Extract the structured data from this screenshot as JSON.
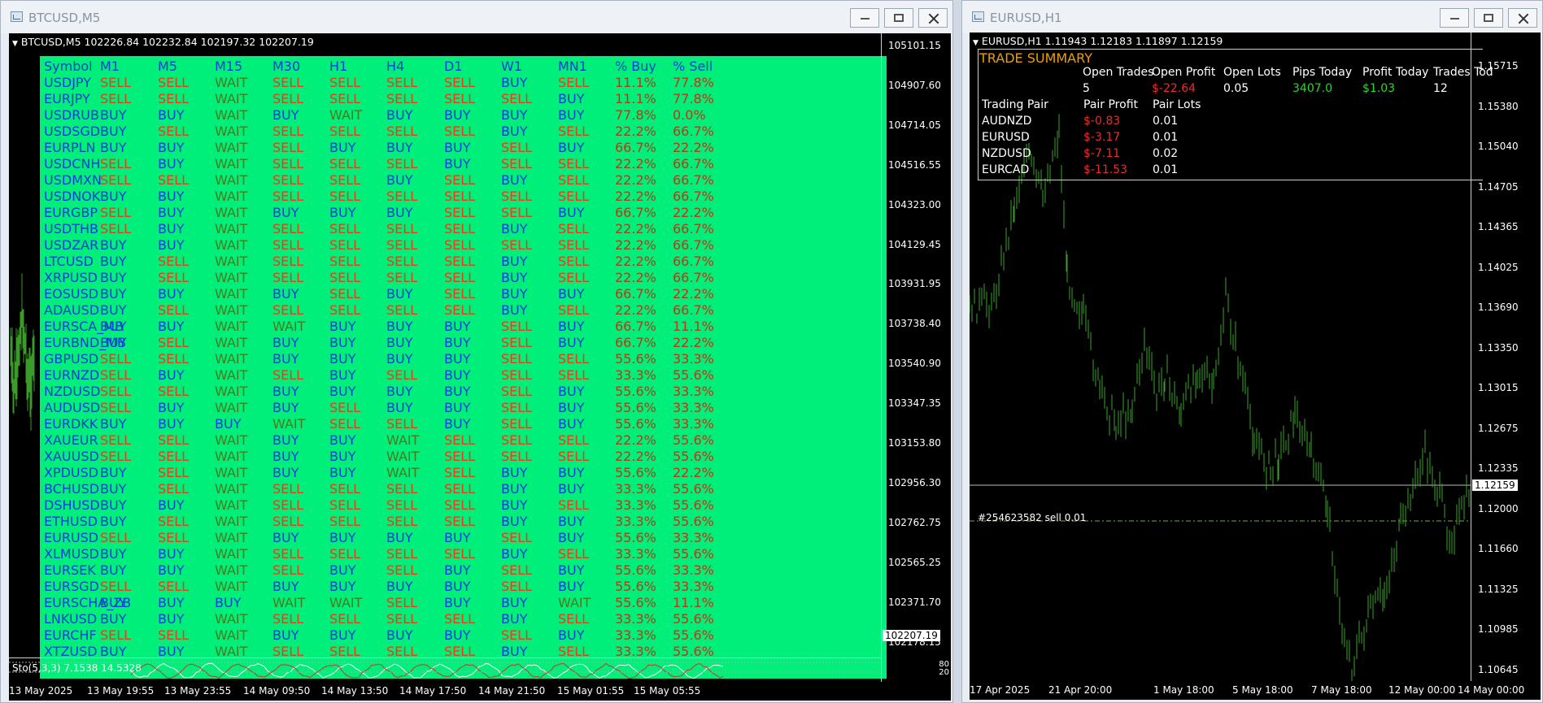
{
  "windows": {
    "left": {
      "title": "BTCUSD,M5"
    },
    "right": {
      "title": "EURUSD,H1"
    }
  },
  "colors": {
    "buy": "#0b3fd8",
    "sell": "#f03a14",
    "wait": "#4a7a1a",
    "symbol": "#0b3fd8",
    "percent": "#b83a16",
    "header": "#0b3fd8",
    "grid_bg": "#00ee7a",
    "summary_title": "#e6a100",
    "green": "#22dd22",
    "red": "#ee2a2a"
  },
  "btc": {
    "info": "BTCUSD,M5  102226.84 102232.84 102197.32 102207.19",
    "price_labels": [
      "105101.15",
      "104907.60",
      "104714.05",
      "104516.55",
      "104323.00",
      "104129.45",
      "103931.95",
      "103738.40",
      "103540.90",
      "103347.35",
      "103153.80",
      "102956.30",
      "102762.75",
      "102565.25",
      "102371.70",
      "102178.15"
    ],
    "current_price": "102207.19",
    "time_labels": [
      "13 May 2025",
      "13 May 19:55",
      "13 May 23:55",
      "14 May 09:50",
      "14 May 13:50",
      "14 May 17:50",
      "14 May 21:50",
      "15 May 01:55",
      "15 May 05:55"
    ],
    "stochastic": {
      "label": "Sto(5,3,3) 7.1538 14.5328",
      "level_high": "80",
      "level_low": "20"
    }
  },
  "signal_grid": {
    "headers": [
      "Symbol",
      "M1",
      "M5",
      "M15",
      "M30",
      "H1",
      "H4",
      "D1",
      "W1",
      "MN1",
      "% Buy",
      "% Sell"
    ],
    "rows": [
      [
        "USDJPY",
        "SELL",
        "SELL",
        "WAIT",
        "SELL",
        "SELL",
        "SELL",
        "SELL",
        "BUY",
        "SELL",
        "11.1%",
        "77.8%"
      ],
      [
        "EURJPY",
        "SELL",
        "SELL",
        "WAIT",
        "SELL",
        "SELL",
        "SELL",
        "SELL",
        "SELL",
        "BUY",
        "11.1%",
        "77.8%"
      ],
      [
        "USDRUB",
        "BUY",
        "BUY",
        "WAIT",
        "BUY",
        "WAIT",
        "BUY",
        "BUY",
        "BUY",
        "BUY",
        "77.8%",
        "0.0%"
      ],
      [
        "USDSGD",
        "BUY",
        "SELL",
        "WAIT",
        "SELL",
        "SELL",
        "SELL",
        "SELL",
        "BUY",
        "SELL",
        "22.2%",
        "66.7%"
      ],
      [
        "EURPLN",
        "BUY",
        "BUY",
        "WAIT",
        "SELL",
        "BUY",
        "BUY",
        "BUY",
        "SELL",
        "BUY",
        "66.7%",
        "22.2%"
      ],
      [
        "USDCNH",
        "SELL",
        "BUY",
        "WAIT",
        "SELL",
        "SELL",
        "SELL",
        "BUY",
        "SELL",
        "SELL",
        "22.2%",
        "66.7%"
      ],
      [
        "USDMXN",
        "SELL",
        "SELL",
        "WAIT",
        "SELL",
        "SELL",
        "BUY",
        "SELL",
        "BUY",
        "SELL",
        "22.2%",
        "66.7%"
      ],
      [
        "USDNOK",
        "BUY",
        "BUY",
        "WAIT",
        "SELL",
        "SELL",
        "SELL",
        "SELL",
        "SELL",
        "SELL",
        "22.2%",
        "66.7%"
      ],
      [
        "EURGBP",
        "SELL",
        "BUY",
        "WAIT",
        "BUY",
        "BUY",
        "BUY",
        "SELL",
        "SELL",
        "BUY",
        "66.7%",
        "22.2%"
      ],
      [
        "USDTHB",
        "SELL",
        "BUY",
        "WAIT",
        "SELL",
        "SELL",
        "SELL",
        "SELL",
        "BUY",
        "SELL",
        "22.2%",
        "66.7%"
      ],
      [
        "USDZAR",
        "BUY",
        "BUY",
        "WAIT",
        "SELL",
        "SELL",
        "SELL",
        "SELL",
        "SELL",
        "SELL",
        "22.2%",
        "66.7%"
      ],
      [
        "LTCUSD",
        "BUY",
        "SELL",
        "WAIT",
        "SELL",
        "SELL",
        "SELL",
        "SELL",
        "BUY",
        "SELL",
        "22.2%",
        "66.7%"
      ],
      [
        "XRPUSD",
        "BUY",
        "SELL",
        "WAIT",
        "SELL",
        "SELL",
        "SELL",
        "SELL",
        "BUY",
        "SELL",
        "22.2%",
        "66.7%"
      ],
      [
        "EOSUSD",
        "BUY",
        "BUY",
        "WAIT",
        "BUY",
        "SELL",
        "BUY",
        "SELL",
        "BUY",
        "BUY",
        "66.7%",
        "22.2%"
      ],
      [
        "ADAUSD",
        "BUY",
        "SELL",
        "WAIT",
        "SELL",
        "SELL",
        "SELL",
        "SELL",
        "BUY",
        "SELL",
        "22.2%",
        "66.7%"
      ],
      [
        "EURSCA_MB",
        "BUY",
        "BUY",
        "WAIT",
        "WAIT",
        "BUY",
        "BUY",
        "BUY",
        "SELL",
        "BUY",
        "66.7%",
        "11.1%"
      ],
      [
        "EURBND_MB",
        "BUY",
        "SELL",
        "WAIT",
        "BUY",
        "BUY",
        "BUY",
        "BUY",
        "SELL",
        "BUY",
        "66.7%",
        "22.2%"
      ],
      [
        "GBPUSD",
        "SELL",
        "SELL",
        "WAIT",
        "BUY",
        "BUY",
        "BUY",
        "BUY",
        "SELL",
        "SELL",
        "55.6%",
        "33.3%"
      ],
      [
        "EURNZD",
        "SELL",
        "BUY",
        "WAIT",
        "SELL",
        "BUY",
        "SELL",
        "BUY",
        "SELL",
        "SELL",
        "33.3%",
        "55.6%"
      ],
      [
        "NZDUSD",
        "SELL",
        "SELL",
        "WAIT",
        "BUY",
        "BUY",
        "BUY",
        "BUY",
        "SELL",
        "BUY",
        "55.6%",
        "33.3%"
      ],
      [
        "AUDUSD",
        "SELL",
        "BUY",
        "WAIT",
        "BUY",
        "SELL",
        "BUY",
        "BUY",
        "SELL",
        "BUY",
        "55.6%",
        "33.3%"
      ],
      [
        "EURDKK",
        "BUY",
        "BUY",
        "BUY",
        "WAIT",
        "SELL",
        "SELL",
        "BUY",
        "SELL",
        "BUY",
        "55.6%",
        "33.3%"
      ],
      [
        "XAUEUR",
        "SELL",
        "SELL",
        "WAIT",
        "BUY",
        "BUY",
        "WAIT",
        "SELL",
        "SELL",
        "SELL",
        "22.2%",
        "55.6%"
      ],
      [
        "XAUUSD",
        "SELL",
        "SELL",
        "WAIT",
        "BUY",
        "BUY",
        "WAIT",
        "SELL",
        "SELL",
        "SELL",
        "22.2%",
        "55.6%"
      ],
      [
        "XPDUSD",
        "BUY",
        "SELL",
        "WAIT",
        "BUY",
        "BUY",
        "WAIT",
        "SELL",
        "BUY",
        "BUY",
        "55.6%",
        "22.2%"
      ],
      [
        "BCHUSD",
        "BUY",
        "SELL",
        "WAIT",
        "SELL",
        "SELL",
        "SELL",
        "SELL",
        "BUY",
        "BUY",
        "33.3%",
        "55.6%"
      ],
      [
        "DSHUSD",
        "BUY",
        "BUY",
        "WAIT",
        "SELL",
        "SELL",
        "SELL",
        "SELL",
        "BUY",
        "SELL",
        "33.3%",
        "55.6%"
      ],
      [
        "ETHUSD",
        "BUY",
        "SELL",
        "WAIT",
        "SELL",
        "SELL",
        "SELL",
        "SELL",
        "BUY",
        "BUY",
        "33.3%",
        "55.6%"
      ],
      [
        "EURUSD",
        "SELL",
        "SELL",
        "WAIT",
        "BUY",
        "BUY",
        "BUY",
        "BUY",
        "SELL",
        "BUY",
        "55.6%",
        "33.3%"
      ],
      [
        "XLMUSD",
        "BUY",
        "BUY",
        "WAIT",
        "SELL",
        "SELL",
        "SELL",
        "SELL",
        "BUY",
        "SELL",
        "33.3%",
        "55.6%"
      ],
      [
        "EURSEK",
        "BUY",
        "BUY",
        "WAIT",
        "SELL",
        "BUY",
        "SELL",
        "BUY",
        "SELL",
        "BUY",
        "55.6%",
        "33.3%"
      ],
      [
        "EURSGD",
        "SELL",
        "SELL",
        "WAIT",
        "BUY",
        "BUY",
        "BUY",
        "BUY",
        "SELL",
        "BUY",
        "55.6%",
        "33.3%"
      ],
      [
        "EURSCHA_ZB",
        "BUY",
        "BUY",
        "BUY",
        "WAIT",
        "WAIT",
        "SELL",
        "BUY",
        "BUY",
        "WAIT",
        "55.6%",
        "11.1%"
      ],
      [
        "LNKUSD",
        "BUY",
        "BUY",
        "WAIT",
        "SELL",
        "SELL",
        "SELL",
        "SELL",
        "BUY",
        "SELL",
        "33.3%",
        "55.6%"
      ],
      [
        "EURCHF",
        "SELL",
        "SELL",
        "WAIT",
        "BUY",
        "BUY",
        "BUY",
        "BUY",
        "SELL",
        "BUY",
        "33.3%",
        "55.6%"
      ],
      [
        "XTZUSD",
        "BUY",
        "BUY",
        "WAIT",
        "SELL",
        "SELL",
        "SELL",
        "SELL",
        "BUY",
        "SELL",
        "33.3%",
        "55.6%"
      ]
    ]
  },
  "eur": {
    "info": "EURUSD,H1  1.11943 1.12183 1.11897 1.12159",
    "price_labels": [
      "1.15715",
      "1.15380",
      "1.15040",
      "1.14705",
      "1.14365",
      "1.14025",
      "1.13690",
      "1.13350",
      "1.13015",
      "1.12675",
      "1.12335",
      "1.12000",
      "1.11660",
      "1.11325",
      "1.10985",
      "1.10645"
    ],
    "current_price": "1.12159",
    "trade_label": "#254623582 sell 0.01",
    "time_labels": [
      "17 Apr 2025",
      "21 Apr 20:00",
      "1 May 18:00",
      "5 May 18:00",
      "7 May 18:00",
      "12 May 00:00",
      "14 May 00:00"
    ],
    "summary": {
      "title": "TRADE SUMMARY",
      "headers": [
        "Open Trades",
        "Open Profit",
        "Open Lots",
        "Pips Today",
        "Profit Today",
        "Trades Tod"
      ],
      "values": [
        "5",
        "$-22.64",
        "0.05",
        "3407.0",
        "$1.03",
        "12"
      ],
      "pair_headers": [
        "Trading Pair",
        "Pair Profit",
        "Pair Lots"
      ],
      "pairs": [
        [
          "AUDNZD",
          "$-0.83",
          "0.01"
        ],
        [
          "EURUSD",
          "$-3.17",
          "0.01"
        ],
        [
          "NZDUSD",
          "$-7.11",
          "0.02"
        ],
        [
          "EURCAD",
          "$-11.53",
          "0.01"
        ]
      ]
    }
  }
}
